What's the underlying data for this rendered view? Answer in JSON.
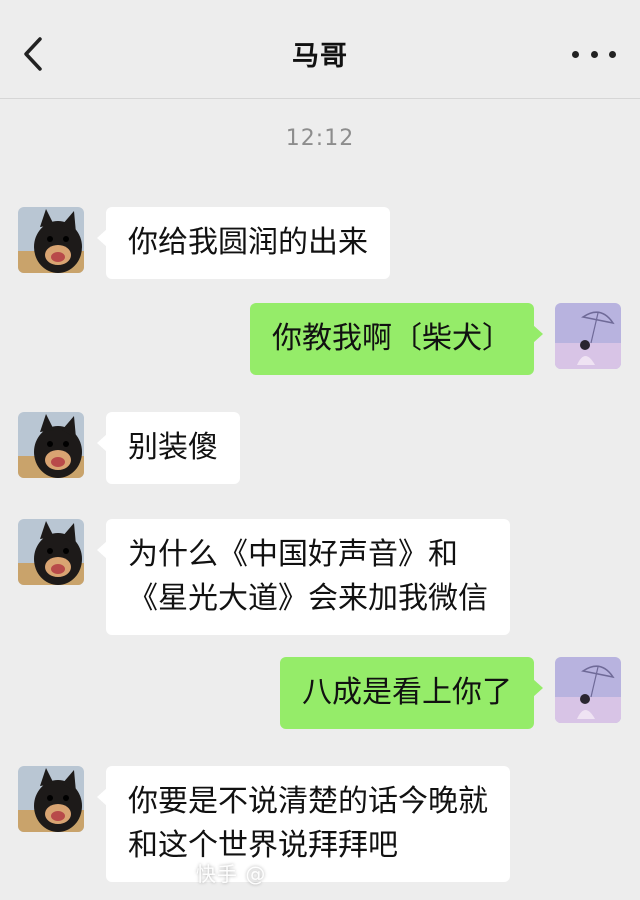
{
  "header": {
    "title": "马哥",
    "back_icon": "chevron-left-icon",
    "more_icon": "more-dots-icon"
  },
  "timestamp": "12:12",
  "messages": [
    {
      "from": "other",
      "lines": [
        "你给我圆润的出来"
      ]
    },
    {
      "from": "me",
      "lines": [
        "你教我啊〔柴犬〕"
      ]
    },
    {
      "from": "other",
      "lines": [
        "别装傻"
      ]
    },
    {
      "from": "other",
      "lines": [
        "为什么《中国好声音》和",
        "《星光大道》会来加我微信"
      ]
    },
    {
      "from": "me",
      "lines": [
        "八成是看上你了"
      ]
    },
    {
      "from": "other",
      "lines": [
        "你要是不说清楚的话今晚就",
        "和这个世界说拜拜吧"
      ]
    }
  ],
  "watermark": "快手 @",
  "colors": {
    "background": "#ededed",
    "incoming_bubble": "#ffffff",
    "outgoing_bubble": "#95ec69"
  }
}
